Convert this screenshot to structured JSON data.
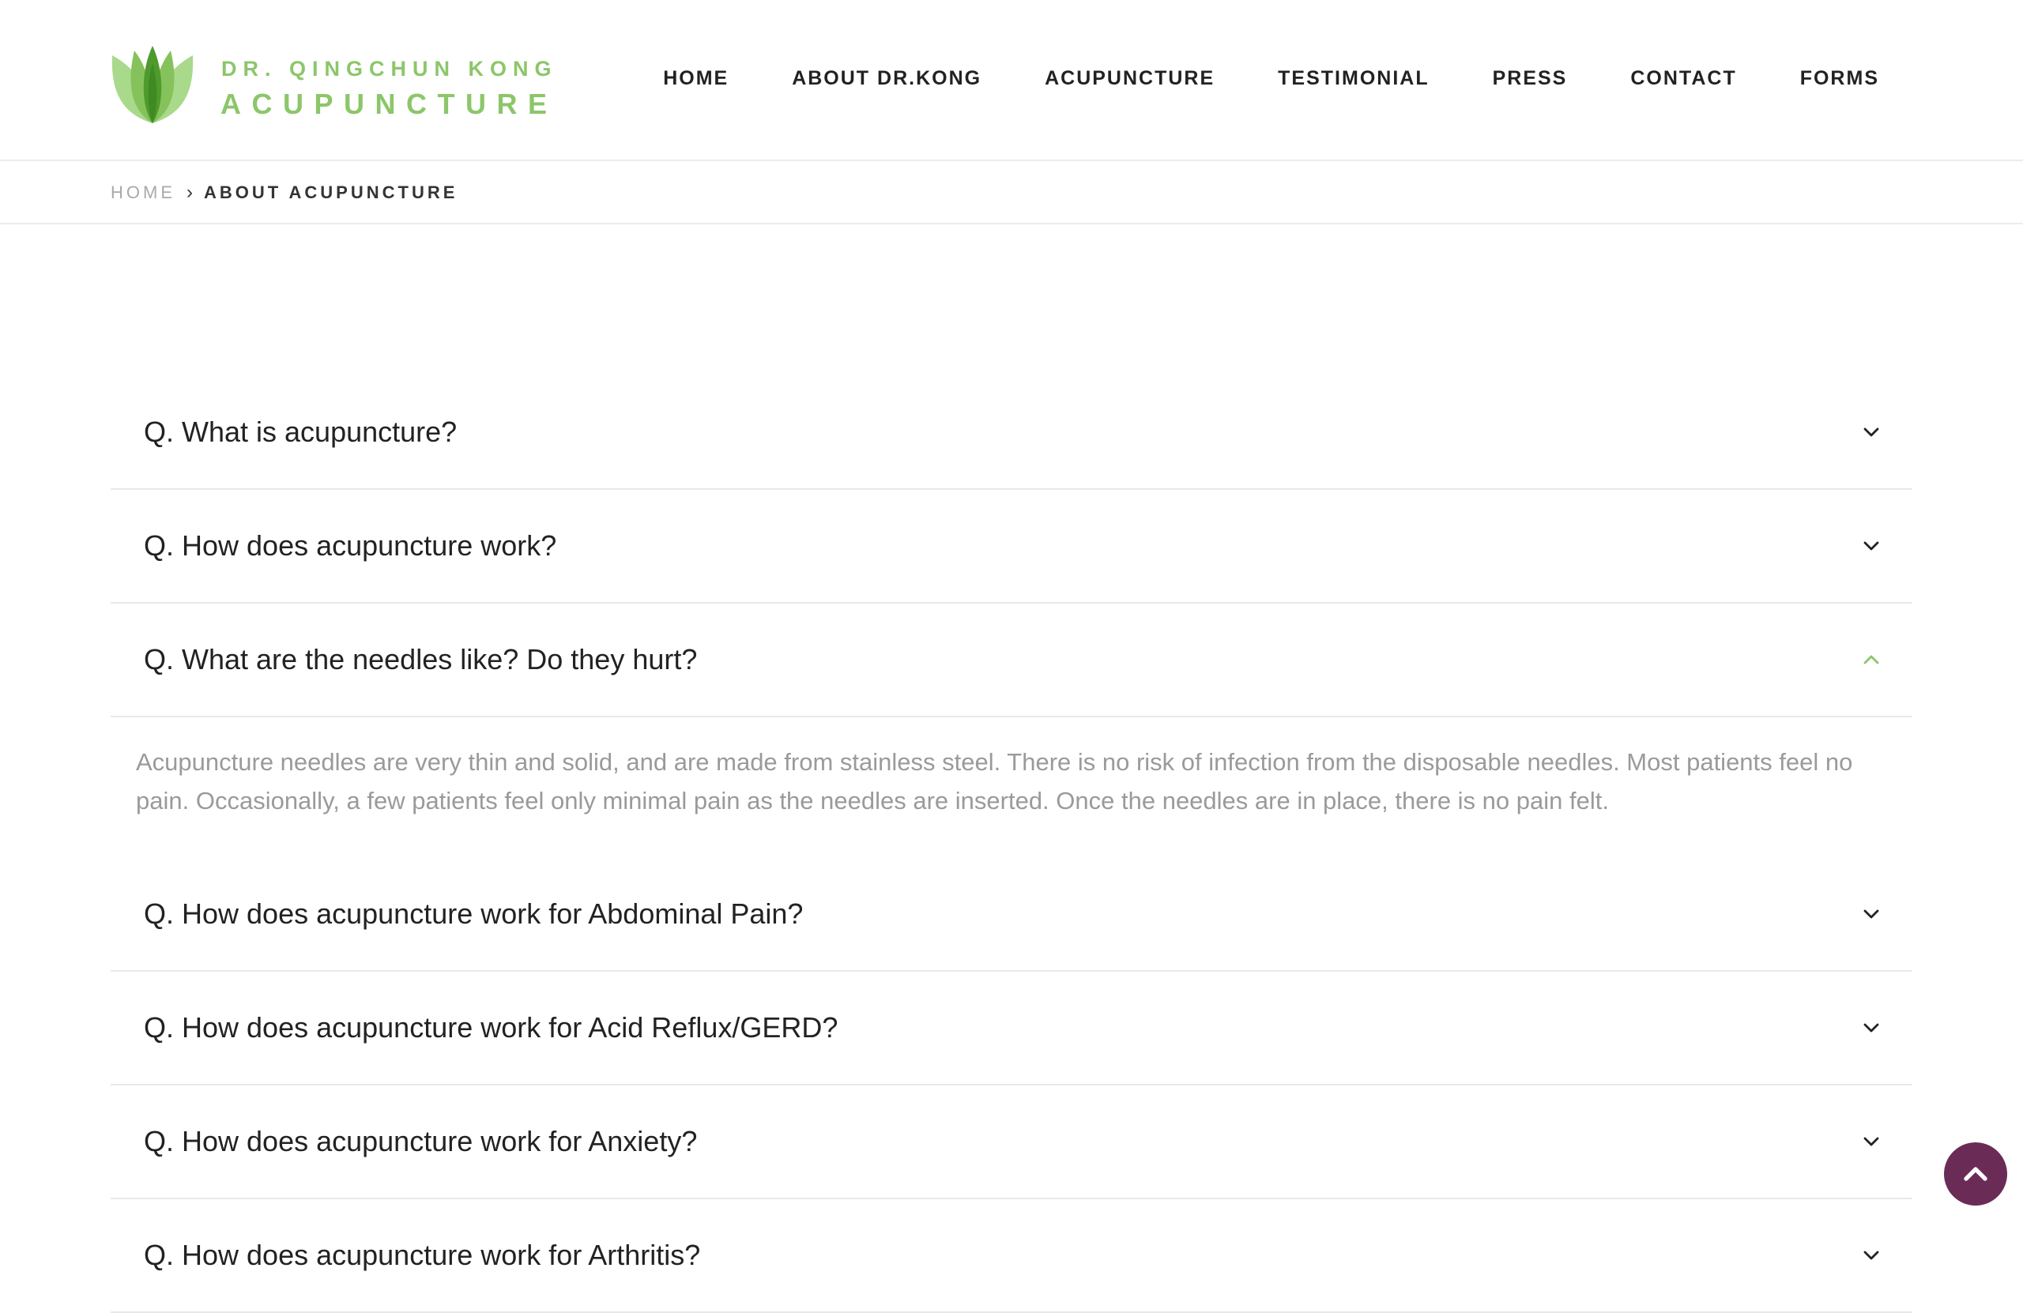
{
  "header": {
    "logo": {
      "line1": "DR. QINGCHUN KONG",
      "line2": "ACUPUNCTURE",
      "icon": "lotus-icon",
      "color": "#8cc66a"
    },
    "nav": [
      {
        "label": "HOME"
      },
      {
        "label": "ABOUT DR.KONG"
      },
      {
        "label": "ACUPUNCTURE"
      },
      {
        "label": "TESTIMONIAL"
      },
      {
        "label": "PRESS"
      },
      {
        "label": "CONTACT"
      },
      {
        "label": "FORMS"
      }
    ]
  },
  "breadcrumb": {
    "home": "HOME",
    "separator": "›",
    "current": "ABOUT ACUPUNCTURE"
  },
  "faq": {
    "items": [
      {
        "question": "Q. What is acupuncture?",
        "expanded": false,
        "icon": "chevron-down-icon"
      },
      {
        "question": "Q. How does acupuncture work?",
        "expanded": false,
        "icon": "chevron-down-icon"
      },
      {
        "question": "Q. What are the needles like? Do they hurt?",
        "expanded": true,
        "icon": "chevron-up-icon",
        "answer": "Acupuncture needles are very thin and solid, and are made from stainless steel. There is no risk of infection from the disposable needles. Most patients feel no pain. Occasionally, a few patients feel only minimal pain as the needles are inserted. Once the needles are in place, there is no pain felt."
      },
      {
        "question": "Q. How does acupuncture work for Abdominal Pain?",
        "expanded": false,
        "icon": "chevron-down-icon"
      },
      {
        "question": "Q. How does acupuncture work for Acid Reflux/GERD?",
        "expanded": false,
        "icon": "chevron-down-icon"
      },
      {
        "question": "Q. How does acupuncture work for Anxiety?",
        "expanded": false,
        "icon": "chevron-down-icon"
      },
      {
        "question": "Q. How does acupuncture work for Arthritis?",
        "expanded": false,
        "icon": "chevron-down-icon"
      }
    ]
  },
  "scroll_to_top": {
    "icon": "chevron-up-icon",
    "color": "#6b2b57"
  },
  "colors": {
    "accent_green": "#8cc66a",
    "active_chevron": "#8cc66a",
    "answer_text": "#9a9a9a"
  }
}
